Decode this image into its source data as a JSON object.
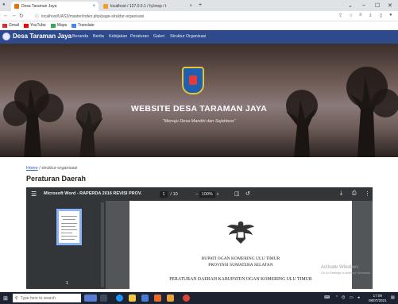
{
  "browser": {
    "tabs": [
      {
        "label": "Desa Taraman Jaya",
        "active": true,
        "color": "#e8710a"
      },
      {
        "label": "localhost / 127.0.0.1 / hj.lmsp / t",
        "active": false,
        "color": "#f2a02c"
      }
    ],
    "new_tab": "+",
    "url": "localhost/UAS3/master/index.php/page-struktur-organisasi",
    "bookmarks": [
      {
        "label": "Gmail",
        "color": "#d93025"
      },
      {
        "label": "YouTube",
        "color": "#ff0000"
      },
      {
        "label": "Maps",
        "color": "#34a853"
      },
      {
        "label": "Translate",
        "color": "#4285f4"
      }
    ]
  },
  "site": {
    "brand": "Desa Taraman Jaya",
    "nav": [
      "Beranda",
      "Berita",
      "Kebijakan",
      "Peraturan",
      "Galeri",
      "Struktur Organisasi"
    ],
    "hero_title": "WEBSITE DESA TARAMAN JAYA",
    "hero_subtitle": "\"Menuju Desa Mandiri dan Sejahtera\"",
    "breadcrumb_home": "Home",
    "breadcrumb_current": "/ struktur-organisasi",
    "page_title": "Peraturan Daerah"
  },
  "pdf": {
    "filename": "Microsoft Word - RAPERDA 2016 REVISI PROV.",
    "page_current": "1",
    "page_total": "/ 10",
    "zoom": "100%",
    "thumb_label": "1",
    "doc_line1": "BUPATI OGAN KOMERING ULU TIMUR",
    "doc_line2": "PROVINSI SUMATERA SELATAN",
    "doc_line3": "PERATURAN DAERAH KABUPATEN OGAN KOMERING ULU TIMUR"
  },
  "watermark": {
    "title": "Activate Windows",
    "subtitle": "Go to Settings to activate Windows."
  },
  "taskbar": {
    "search_placeholder": "Type here to search",
    "time": "17:08",
    "date": "08/07/2021"
  }
}
